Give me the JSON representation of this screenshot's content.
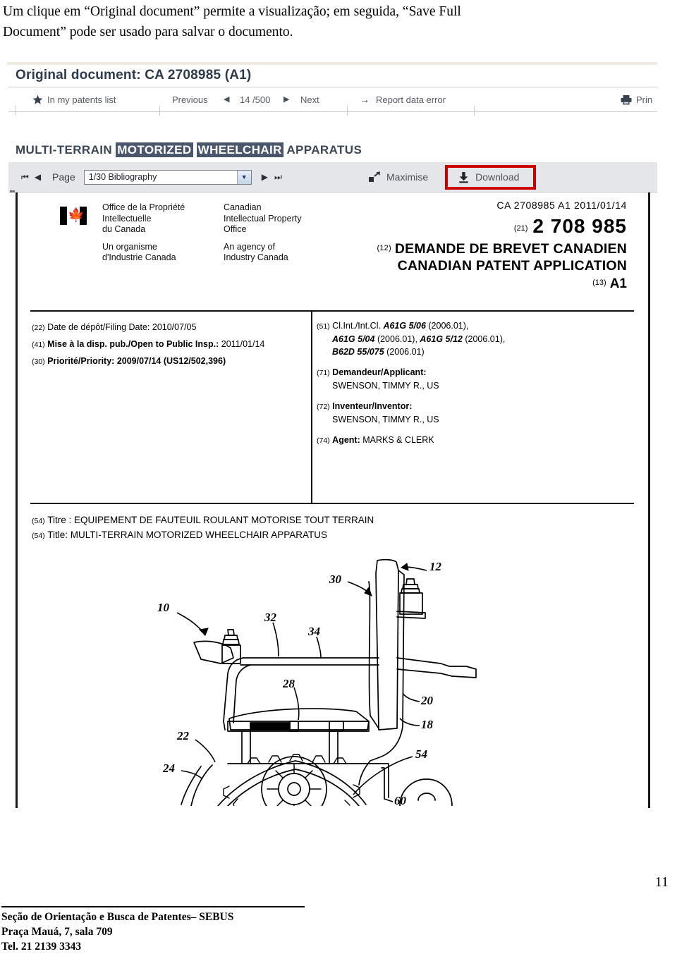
{
  "intro": {
    "line1": "Um clique em “Original document” permite a visualização; em seguida, “Save Full",
    "line2": "Document” pode ser usado para salvar o documento."
  },
  "viewer": {
    "doc_title": "Original document: CA 2708985  (A1)",
    "toolbar": {
      "in_my_list": "In my patents list",
      "previous": "Previous",
      "counter": "14 /500",
      "next": "Next",
      "report_error": "Report data error",
      "print": "Prin",
      "star_icon": "star-icon",
      "printer_icon": "printer-icon",
      "prev_arrow": "◀",
      "next_arrow": "▶",
      "report_arrow": "→"
    },
    "patent_title": {
      "part1": "MULTI-TERRAIN ",
      "highlight1": "MOTORIZED",
      "gap": " ",
      "highlight2": "WHEELCHAIR",
      "part2": " APPARATUS",
      "highlight_color": "#49566b"
    },
    "pagebar": {
      "first_icon": "⏮",
      "prev_icon": "◀",
      "page_label": "Page",
      "select_value": "1/30 Bibliography",
      "caret": "▼",
      "next_icon": "▶",
      "last_icon": "⏭",
      "maximise": "Maximise",
      "download": "Download",
      "maximise_icon": "maximise-icon",
      "download_icon": "download-icon",
      "download_highlight_color": "#cc0000"
    }
  },
  "document": {
    "masthead": {
      "fr_line1": "Office de la Propriété",
      "fr_line2": "Intellectuelle",
      "fr_line3": "du Canada",
      "fr_sub1": "Un organisme",
      "fr_sub2": "d'Industrie Canada",
      "en_line1": "Canadian",
      "en_line2": "Intellectual Property",
      "en_line3": "Office",
      "en_sub1": "An agency of",
      "en_sub2": "Industry Canada",
      "flag_icon": "canada-flag-icon"
    },
    "header": {
      "ref_line": "CA  2708985  A1  2011/01/14",
      "code_21": "(21)",
      "pub_number": "2 708 985",
      "code_12": "(12)",
      "title_fr": "DEMANDE DE BREVET CANADIEN",
      "title_en": "CANADIAN PATENT APPLICATION",
      "code_13": "(13)",
      "kind_code": "A1"
    },
    "left_fields": [
      {
        "code": "(22)",
        "label": "Date de dépôt/Filing Date:",
        "value": " 2010/07/05",
        "bold": false
      },
      {
        "code": "(41)",
        "label": "Mise à la disp. pub./Open to Public Insp.:",
        "value": " 2011/01/14",
        "bold": true
      },
      {
        "code": "(30)",
        "label": "Priorité/Priority:",
        "value": " 2009/07/14 (US12/502,396)",
        "bold": true
      }
    ],
    "right_fields": {
      "ipc_code": "(51)",
      "ipc_label": "Cl.Int./Int.Cl.",
      "ipc_line1": "A61G 5/06",
      "ipc_line1_year": " (2006.01),",
      "ipc_line2a": "A61G 5/04",
      "ipc_line2a_year": " (2006.01), ",
      "ipc_line2b": "A61G 5/12",
      "ipc_line2b_year": " (2006.01),",
      "ipc_line3": "B62D 55/075",
      "ipc_line3_year": " (2006.01)",
      "applicant_code": "(71)",
      "applicant_label": "Demandeur/Applicant:",
      "applicant_value": "SWENSON, TIMMY R., US",
      "inventor_code": "(72)",
      "inventor_label": "Inventeur/Inventor:",
      "inventor_value": "SWENSON, TIMMY R., US",
      "agent_code": "(74)",
      "agent_label": "Agent:",
      "agent_value": " MARKS & CLERK"
    },
    "titles": {
      "code_fr": "(54)",
      "label_fr": "Titre : ",
      "title_fr": "EQUIPEMENT DE FAUTEUIL ROULANT MOTORISE TOUT TERRAIN",
      "code_en": "(54)",
      "label_en": "Title: ",
      "title_en": " MULTI-TERRAIN MOTORIZED WHEELCHAIR APPARATUS"
    },
    "figure": {
      "name": "wheelchair-side-view-figure",
      "ref_numbers": [
        "10",
        "12",
        "30",
        "32",
        "34",
        "28",
        "20",
        "18",
        "22",
        "24",
        "54",
        "60"
      ]
    }
  },
  "page_number": "11",
  "footer": {
    "line1": "Seção de Orientação e Busca de Patentes– SEBUS",
    "line2": "Praça Mauá, 7, sala 709",
    "line3": "Tel. 21 2139 3343"
  }
}
